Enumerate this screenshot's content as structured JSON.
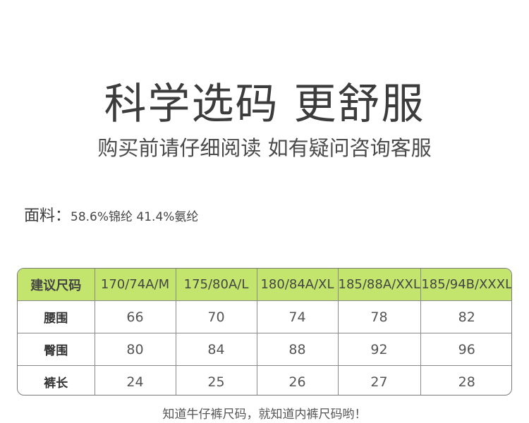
{
  "title": "科学选码 更舒服",
  "subtitle": "购买前请仔细阅读 如有疑问咨询客服",
  "fabric": {
    "label": "面料：",
    "value": "58.6%锦纶 41.4%氨纶"
  },
  "size_table": {
    "header": [
      "建议尺码",
      "170/74A/M",
      "175/80A/L",
      "180/84A/XL",
      "185/88A/XXL",
      "185/94B/XXXL"
    ],
    "rows": [
      {
        "label": "腰围",
        "values": [
          "66",
          "70",
          "74",
          "78",
          "82"
        ]
      },
      {
        "label": "臀围",
        "values": [
          "80",
          "84",
          "88",
          "92",
          "96"
        ]
      },
      {
        "label": "裤长",
        "values": [
          "24",
          "25",
          "26",
          "27",
          "28"
        ]
      }
    ],
    "header_color": "#c3e56e"
  },
  "footer": "知道牛仔裤尺码，就知道内裤尺码哟！"
}
